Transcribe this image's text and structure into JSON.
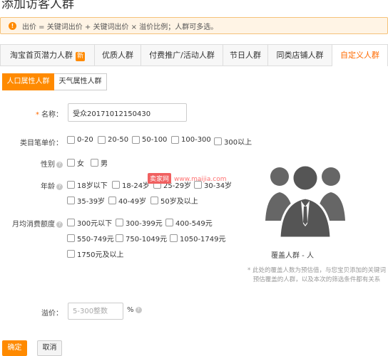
{
  "page": {
    "title": "添加访客人群"
  },
  "notice": {
    "icon": "exclamation-icon",
    "text": "出价 = 关键词出价 + 关键词出价 × 溢价比例；人群可多选。"
  },
  "tabs": [
    {
      "label": "淘宝首页潜力人群",
      "badge": "新"
    },
    {
      "label": "优质人群"
    },
    {
      "label": "付费推广/活动人群"
    },
    {
      "label": "节日人群"
    },
    {
      "label": "同类店铺人群"
    },
    {
      "label": "自定义人群",
      "active": true
    }
  ],
  "subtabs": [
    {
      "label": "人口属性人群",
      "active": true
    },
    {
      "label": "天气属性人群"
    }
  ],
  "form": {
    "name": {
      "label": "名称：",
      "value": "受众20171012150430"
    },
    "price": {
      "label": "类目笔单价：",
      "options": [
        "0-20",
        "20-50",
        "50-100",
        "100-300",
        "300以上"
      ]
    },
    "gender": {
      "label": "性别",
      "options": [
        "女",
        "男"
      ]
    },
    "age": {
      "label": "年龄",
      "options": [
        "18岁以下",
        "18-24岁",
        "25-29岁",
        "30-34岁",
        "35-39岁",
        "40-49岁",
        "50岁及以上"
      ]
    },
    "spend": {
      "label": "月均消费额度",
      "options": [
        "300元以下",
        "300-399元",
        "400-549元",
        "550-749元",
        "750-1049元",
        "1050-1749元",
        "1750元及以上"
      ]
    },
    "premium": {
      "label": "溢价：",
      "placeholder": "5-300整数",
      "unit": "%"
    }
  },
  "coverage": {
    "icon": "user-group-icon",
    "label": "覆盖人群 - 人",
    "description": "* 此处的覆盖人数为预估值，与您宝贝添加的关键词预估覆盖的人群，以及本次的筛选条件都有关系"
  },
  "watermark": {
    "brand": "卖家网",
    "url": "www.maijia.com"
  },
  "buttons": {
    "confirm": "确定",
    "cancel": "取消"
  },
  "colors": {
    "accent": "#ff8a00",
    "active_tab_text": "#ff6a00",
    "notice_bg": "#fff4e5"
  }
}
